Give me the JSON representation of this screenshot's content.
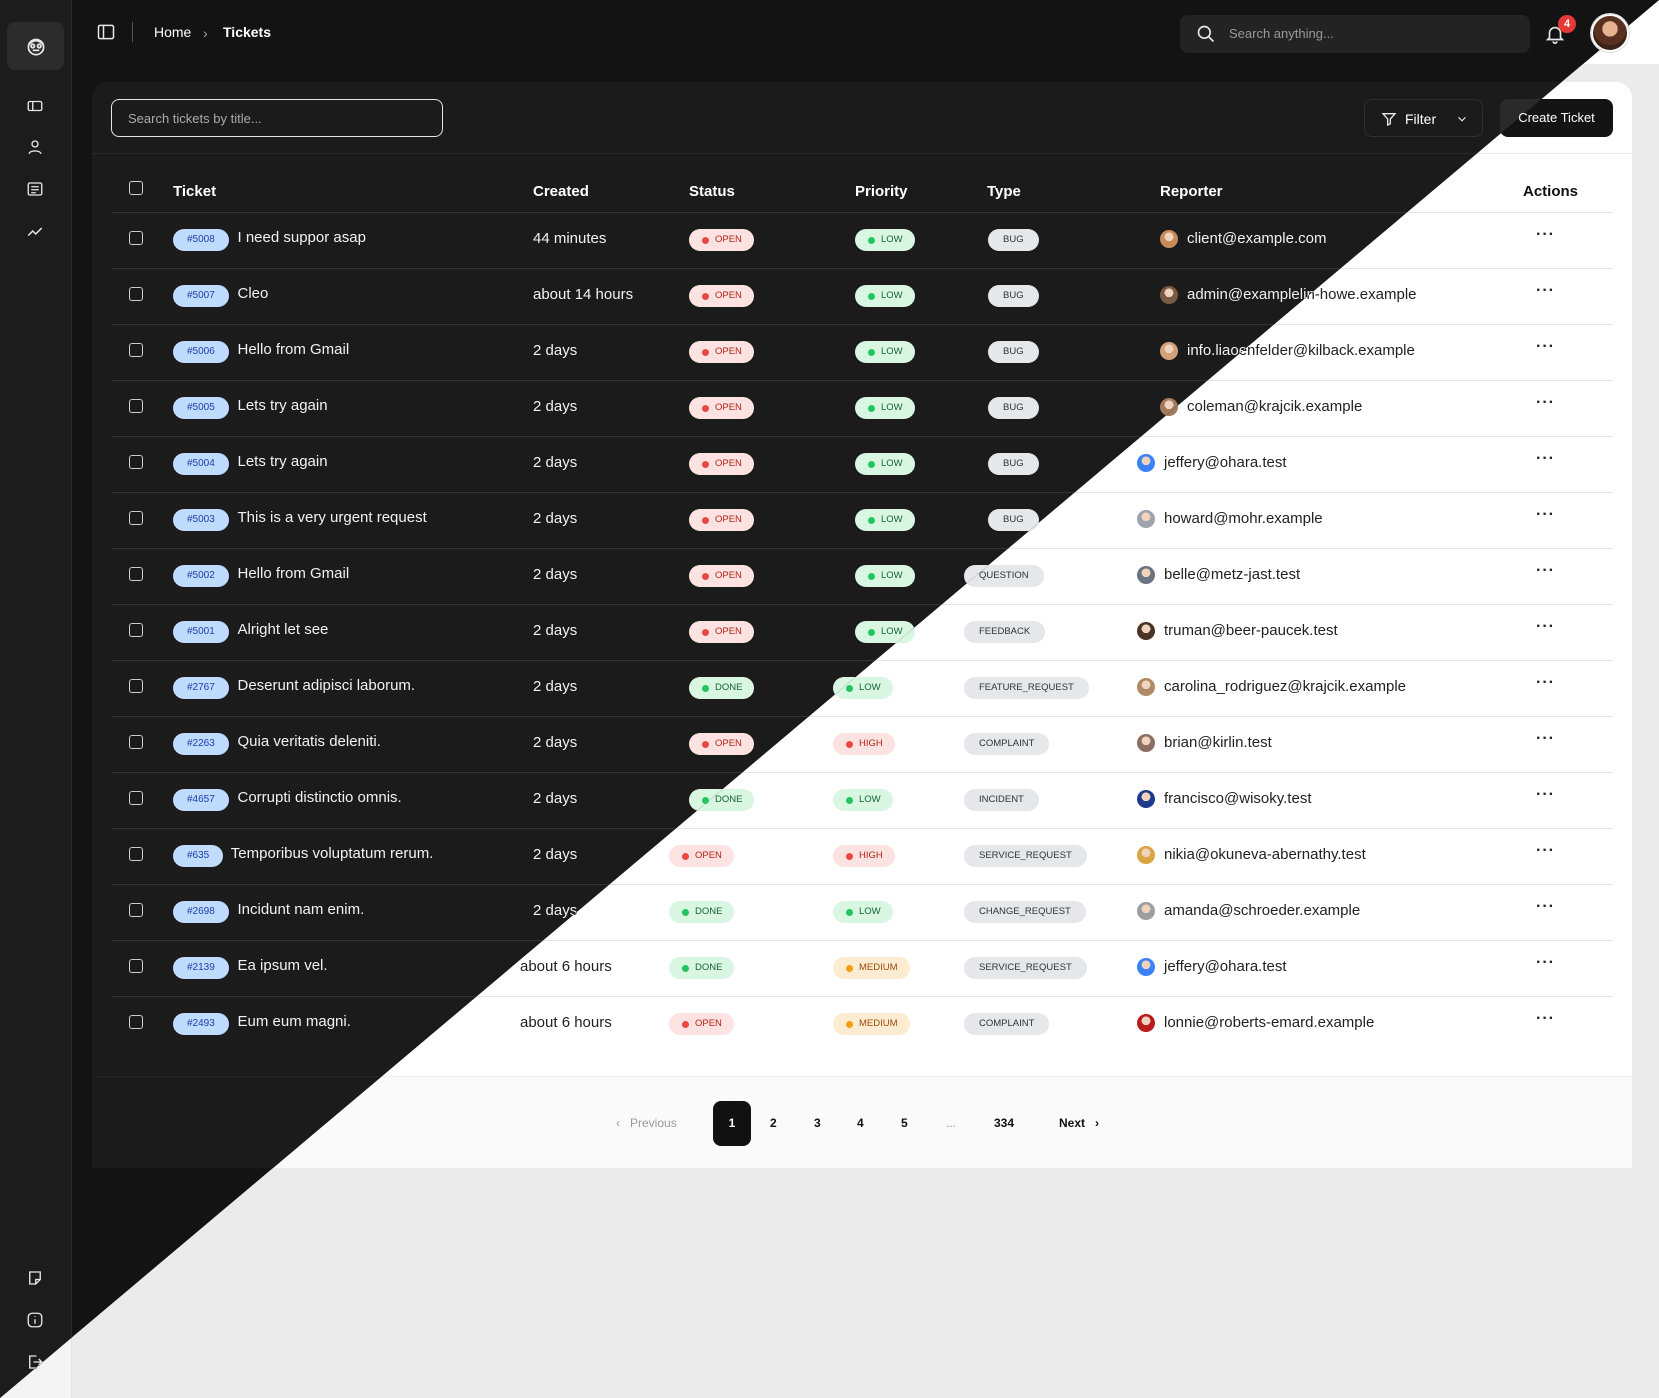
{
  "breadcrumb": {
    "home": "Home",
    "separator": "›",
    "current": "Tickets"
  },
  "global_search": {
    "placeholder": "Search anything..."
  },
  "notifications": {
    "count": "4"
  },
  "toolbar": {
    "search_placeholder": "Search tickets by title...",
    "filter_label": "Filter",
    "create_label": "Create Ticket"
  },
  "table": {
    "columns": [
      "Ticket",
      "Created",
      "Status",
      "Priority",
      "Type",
      "Reporter",
      "Actions"
    ],
    "rows": [
      {
        "id": "#5008",
        "title": "I need suppor asap",
        "created": "44 minutes",
        "status": "OPEN",
        "priority": "LOW",
        "type": "BUG",
        "reporter": "client@example.com"
      },
      {
        "id": "#5007",
        "title": "Cleo",
        "created": "about 14 hours",
        "status": "OPEN",
        "priority": "LOW",
        "type": "BUG",
        "reporter": "admin@examplelin-howe.example"
      },
      {
        "id": "#5006",
        "title": "Hello from Gmail",
        "created": "2 days",
        "status": "OPEN",
        "priority": "LOW",
        "type": "BUG",
        "reporter": "info.liaoenfelder@kilback.example"
      },
      {
        "id": "#5005",
        "title": "Lets try again",
        "created": "2 days",
        "status": "OPEN",
        "priority": "LOW",
        "type": "BUG",
        "reporter": "coleman@krajcik.example"
      },
      {
        "id": "#5004",
        "title": "Lets try again",
        "created": "2 days",
        "status": "OPEN",
        "priority": "LOW",
        "type": "BUG",
        "reporter": "jeffery@ohara.test"
      },
      {
        "id": "#5003",
        "title": "This is a very urgent request",
        "created": "2 days",
        "status": "OPEN",
        "priority": "LOW",
        "type": "BUG",
        "reporter": "howard@mohr.example"
      },
      {
        "id": "#5002",
        "title": "Hello from Gmail",
        "created": "2 days",
        "status": "OPEN",
        "priority": "LOW",
        "type": "QUESTION",
        "reporter": "belle@metz-jast.test"
      },
      {
        "id": "#5001",
        "title": "Alright let see",
        "created": "2 days",
        "status": "OPEN",
        "priority": "LOW",
        "type": "FEEDBACK",
        "reporter": "truman@beer-paucek.test"
      },
      {
        "id": "#2767",
        "title": "Deserunt adipisci laborum.",
        "created": "2 days",
        "status": "DONE",
        "priority": "LOW",
        "type": "FEATURE_REQUEST",
        "reporter": "carolina_rodriguez@krajcik.example"
      },
      {
        "id": "#2263",
        "title": "Quia veritatis deleniti.",
        "created": "2 days",
        "status": "OPEN",
        "priority": "HIGH",
        "type": "COMPLAINT",
        "reporter": "brian@kirlin.test"
      },
      {
        "id": "#4657",
        "title": "Corrupti distinctio omnis.",
        "created": "2 days",
        "status": "DONE",
        "priority": "LOW",
        "type": "INCIDENT",
        "reporter": "francisco@wisoky.test"
      },
      {
        "id": "#635",
        "title": "Temporibus voluptatum rerum.",
        "created": "2 days",
        "status": "OPEN",
        "priority": "HIGH",
        "type": "SERVICE_REQUEST",
        "reporter": "nikia@okuneva-abernathy.test"
      },
      {
        "id": "#2698",
        "title": "Incidunt nam enim.",
        "created": "2 days",
        "status": "DONE",
        "priority": "LOW",
        "type": "CHANGE_REQUEST",
        "reporter": "amanda@schroeder.example"
      },
      {
        "id": "#2139",
        "title": "Ea ipsum vel.",
        "created": "about 6 hours",
        "status": "DONE",
        "priority": "MEDIUM",
        "type": "SERVICE_REQUEST",
        "reporter": "jeffery@ohara.test"
      },
      {
        "id": "#2493",
        "title": "Eum eum magni.",
        "created": "about 6 hours",
        "status": "OPEN",
        "priority": "MEDIUM",
        "type": "COMPLAINT",
        "reporter": "lonnie@roberts-emard.example"
      }
    ]
  },
  "pagination": {
    "previous": "Previous",
    "pages": [
      "1",
      "2",
      "3",
      "4",
      "5",
      "...",
      "334"
    ],
    "active": "1",
    "next": "Next"
  },
  "icons": {
    "sidebar_top": [
      "logo-icon",
      "ticket-icon",
      "user-icon",
      "list-icon",
      "analytics-icon"
    ],
    "sidebar_bottom": [
      "notes-icon",
      "info-icon",
      "logout-icon"
    ]
  },
  "colors": {
    "ticket_id_bg": "#bfdbfe",
    "open": "#ef4444",
    "done": "#22c55e",
    "medium": "#f59e0b",
    "badge": "#e53935"
  }
}
